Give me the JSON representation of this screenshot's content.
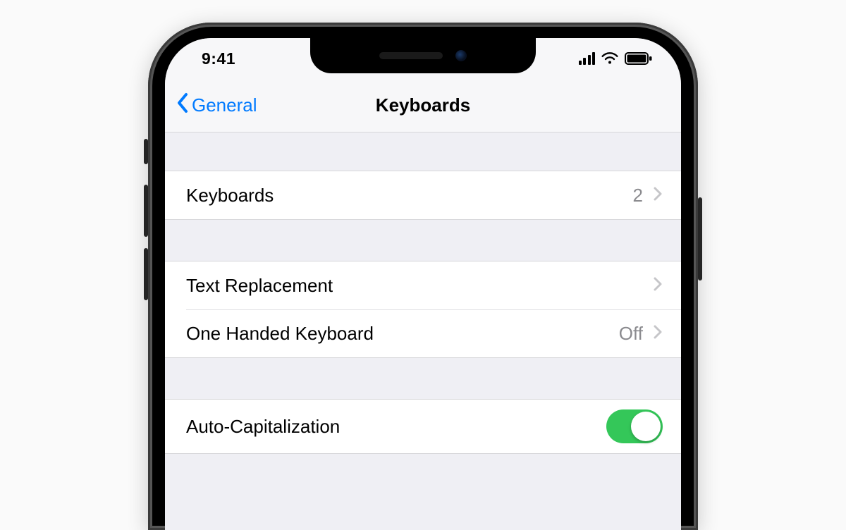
{
  "status": {
    "time": "9:41"
  },
  "nav": {
    "back_label": "General",
    "title": "Keyboards"
  },
  "rows": {
    "keyboards": {
      "label": "Keyboards",
      "value": "2"
    },
    "text_replacement": {
      "label": "Text Replacement"
    },
    "one_handed": {
      "label": "One Handed Keyboard",
      "value": "Off"
    },
    "auto_cap": {
      "label": "Auto-Capitalization",
      "on": true
    }
  },
  "colors": {
    "accent": "#007aff",
    "toggle_on": "#34c759"
  }
}
